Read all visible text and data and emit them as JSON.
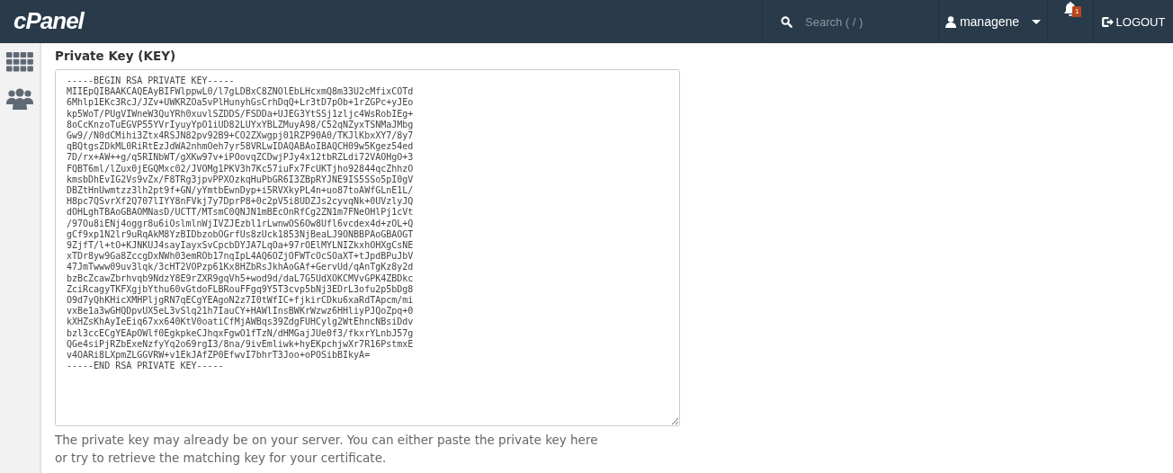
{
  "header": {
    "logo": "cPanel",
    "search": {
      "placeholder": "Search ( / )"
    },
    "user": "managene",
    "notifications": {
      "count": "1"
    },
    "logout": "LOGOUT"
  },
  "sidebar": {
    "items": [
      {
        "kind": "grid",
        "selected": false
      },
      {
        "kind": "users",
        "selected": false
      }
    ]
  },
  "field": {
    "label": "Private Key (KEY)",
    "value_lines": [
      "-----BEGIN RSA PRIVATE KEY-----",
      "MIIEpQIBAAKCAQEAyBIFWlppwL0/l7gLDBxC8ZNOlEbLHcxmQ8m33U2cMfixCOTd",
      "6Mhlp1EKc3RcJ/JZv+UWKRZOa5vPlHunyhGsCrhDqQ+Lr3tD7pOb+1rZGPc+yJEo",
      "kp5WoT/PUgVIWneW3QuYRh0xuvlSZDDS/FSDDa+UJEG3YtSSj1zljc4WsRobIEg+",
      "8oCcKnzoTuEGVP55YVrIyuyYpO1iUD82LUYxYBLZMuyA98/C52qNZyxTSNMaJMbg",
      "Gw9//N0dCMihi3Ztx4RSJN82pv92B9+CO2ZXwgpj01RZP90A0/TKJlKbxXY7/8y7",
      "qBQtgsZDkML0RiRtEzJdWA2nhmOeh7yr58VRLwIDAQABAoIBAQCH09w5Kgez54ed",
      "7D/rx+AW++g/q5RINbWT/gXKw97v+iPOovqZCDwjPJy4x12tbRZLdi72VAOHgO+3",
      "FQBT6ml/lZux0jEGQMxc02/JVOMg1PKV3h7Kc57iuFx7FcUKTjho92844qcZhhzO",
      "kmsbDhEvIG2Vs9vZx/F8TRg3jpvPPXOzkqHuPbGR6I3ZBpRYJNE9IS5SSo5pI0gV",
      "DBZtHnUwmtzz3lh2pt9f+GN/yYmtbEwnDyp+i5RVXkyPL4n+uo87toAWfGLnE1L/",
      "H8pc7QSvrXf2Q707lIYY8nFVkj7y7DprP8+0c2pV5i8UDZJs2cyvqNk+0UVzlyJQ",
      "dOHLghTBAoGBAOMNasD/UCTT/MTsmC0QNJN1mBEcOnRfCg2ZN1m7FNeOHlPj1cVt",
      "/97Ou8iENj4oggr8u6iOslmlnWjIVZJEzbl1rLwnwOS6Ow8Ufl6vcdex4d+zOL+Q",
      "gCf9xp1N2lr9uRqAkM8YzBIDbzobOGrfUs8zUck1853NjBeaLJ9ONBBPAoGBAOGT",
      "9ZjfT/l+tO+KJNKUJ4sayIayxSvCpcbDYJA7LqOa+97rOElMYLNIZkxhOHXgCsNE",
      "xTDr8yw9Ga8ZccgDxNWh03emROb17nqIpL4AQ6OZjOFWTcOcSOaXT+tJpdBPuJbV",
      "47JmTwww09uv3lqk/3cHT2VOPzp61Kx8HZbRsJkhAoGAf+GervUd/qAnTgKz8y2d",
      "bzBcZcawZbrhvqb9NdzY8E9rZXR9gqVh5+wod9d/daL7G5UdXOKCMVvGPK4ZBDkc",
      "ZciRcagyTKFXgjbYthu60vGtdoFLBRouFFgq9Y5T3cvp5bNj3EDrL3ofu2p5bDg8",
      "O9d7yQhKHicXMHPljgRN7qECgYEAgoN2z7I0tWfIC+fjkirCDku6xaRdTApcm/mi",
      "vxBe1a3wGHQDpvUX5eL3vSlq21h7IauCY+HAWlInsBWKrWzwz6HHliyPJQoZpq+0",
      "kXHZsKhAyIeEiq67xx640KtV0oatiCfMjAWBqs39ZdgFUHCylg2WtEhncNBsiDdv",
      "bzl3ccECgYEApOWlf0EgkpkeCJhqxFgwO1fTzN/dHMGajJUe0f3/fkxrYLnbJ57g",
      "QGe4siPjRZbExeNzfyYq2o69rgI3/8na/9ivEmliwk+hyEKpchjwXr7R16PstmxE",
      "v4OARi8LXpmZLGGVRW+v1EkJAfZP0EfwvI7bhrT3Joo+oPOSibBIkyA=",
      "-----END RSA PRIVATE KEY-----"
    ],
    "help": "The private key may already be on your server. You can either paste the private key here or try to retrieve the matching key for your certificate."
  }
}
